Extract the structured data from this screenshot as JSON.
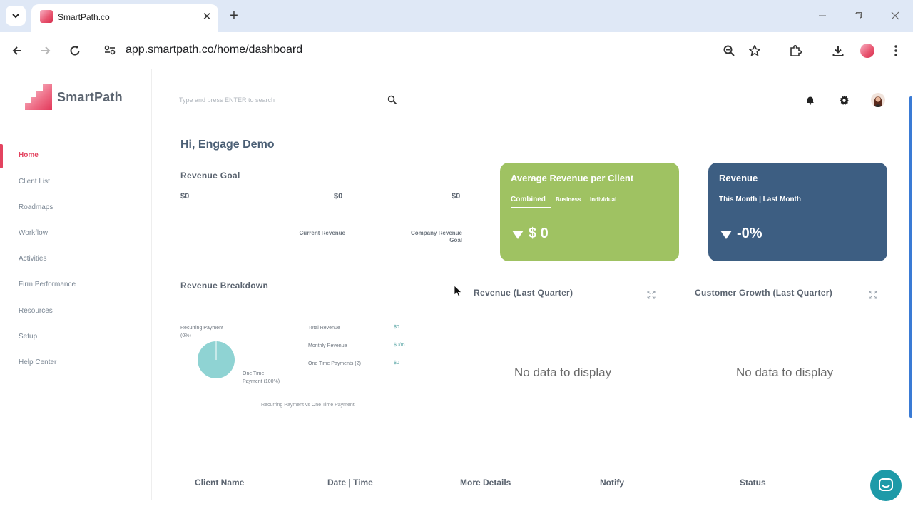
{
  "browser": {
    "tab_title": "SmartPath.co",
    "url": "app.smartpath.co/home/dashboard"
  },
  "app": {
    "brand": "SmartPath",
    "search_placeholder": "Type and press ENTER to search",
    "greeting": "Hi, Engage Demo"
  },
  "sidebar": {
    "items": [
      {
        "label": "Home"
      },
      {
        "label": "Client List"
      },
      {
        "label": "Roadmaps"
      },
      {
        "label": "Workflow"
      },
      {
        "label": "Activities"
      },
      {
        "label": "Firm Performance"
      },
      {
        "label": "Resources"
      },
      {
        "label": "Setup"
      },
      {
        "label": "Help Center"
      }
    ]
  },
  "revenue_goal": {
    "title": "Revenue Goal",
    "start_value": "$0",
    "current_value": "$0",
    "goal_value": "$0",
    "current_label": "Current Revenue",
    "goal_label_line1": "Company Revenue",
    "goal_label_line2": "Goal"
  },
  "avg_revenue_card": {
    "title": "Average Revenue per Client",
    "tabs": [
      "Combined",
      "Business",
      "Individual"
    ],
    "selected_tab": "Combined",
    "value": "$ 0",
    "color": "#9fc262"
  },
  "revenue_card": {
    "title": "Revenue",
    "subtitle": "This Month | Last Month",
    "value": "-0%",
    "color": "#3d5e82"
  },
  "revenue_breakdown": {
    "title": "Revenue Breakdown",
    "recurring_label_line1": "Recurring Payment",
    "recurring_label_line2": "(0%)",
    "one_time_label_line1": "One Time",
    "one_time_label_line2": "Payment (100%)",
    "caption": "Recurring Payment vs One Time Payment",
    "stats": [
      {
        "label": "Total Revenue",
        "value": "$0"
      },
      {
        "label": "Monthly Revenue",
        "value": "$0/m"
      },
      {
        "label": "One Time Payments (2)",
        "value": "$0"
      }
    ],
    "pie_color": "#8fd3d3"
  },
  "revenue_last_quarter": {
    "title": "Revenue (Last Quarter)",
    "empty": "No data to display"
  },
  "customer_growth": {
    "title": "Customer Growth (Last Quarter)",
    "empty": "No data to display"
  },
  "table": {
    "headers": [
      "Client Name",
      "Date | Time",
      "More Details",
      "Notify",
      "Status"
    ]
  },
  "colors": {
    "accent": "#e3435f",
    "chat": "#1e9aa8"
  }
}
